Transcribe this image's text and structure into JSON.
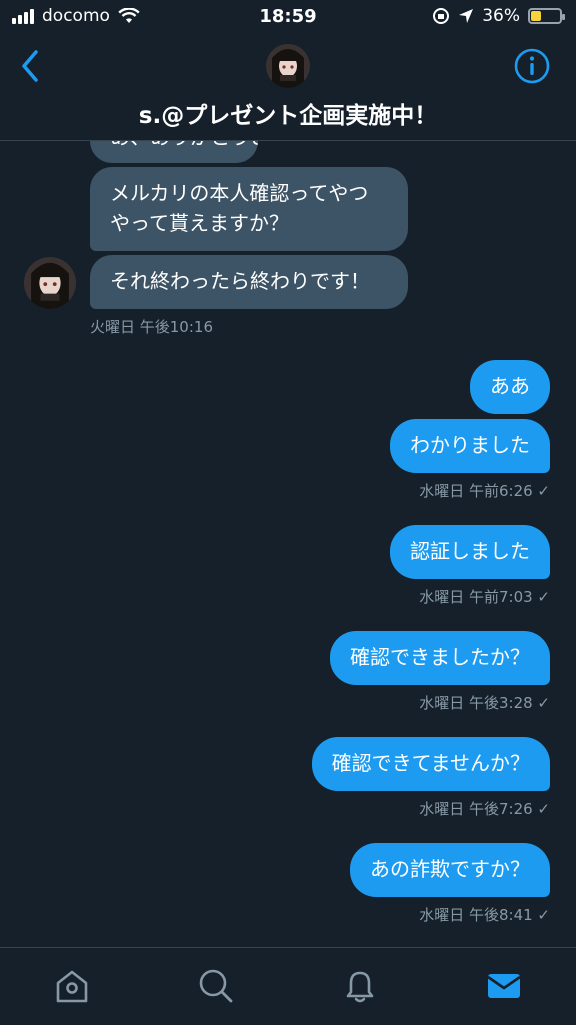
{
  "status_bar": {
    "carrier": "docomo",
    "time": "18:59",
    "battery": "36%",
    "battery_level": 0.36
  },
  "header": {
    "title": "s.@プレゼント企画実施中！"
  },
  "incoming": [
    {
      "text": "あ、ありがとうございます"
    },
    {
      "text": "メルカリの本人確認ってやつやって貰えますか？"
    },
    {
      "text": "それ終わったら終わりです！"
    }
  ],
  "incoming_time": "火曜日 午後10:16",
  "outgoing": [
    {
      "text": "ああ"
    },
    {
      "text": "わかりました",
      "time": "水曜日 午前6:26 ✓"
    },
    {
      "text": "認証しました",
      "time": "水曜日 午前7:03 ✓"
    },
    {
      "text": "確認できましたか？",
      "time": "水曜日 午後3:28 ✓"
    },
    {
      "text": "確認できてませんか？",
      "time": "水曜日 午後7:26 ✓"
    },
    {
      "text": "あの詐欺ですか？",
      "time": "水曜日 午後8:41 ✓"
    }
  ],
  "colors": {
    "background": "#15202b",
    "incoming_bubble": "#3d5466",
    "outgoing_bubble": "#1d9bf0",
    "accent": "#1d9bf0",
    "meta_text": "#8899a6"
  }
}
